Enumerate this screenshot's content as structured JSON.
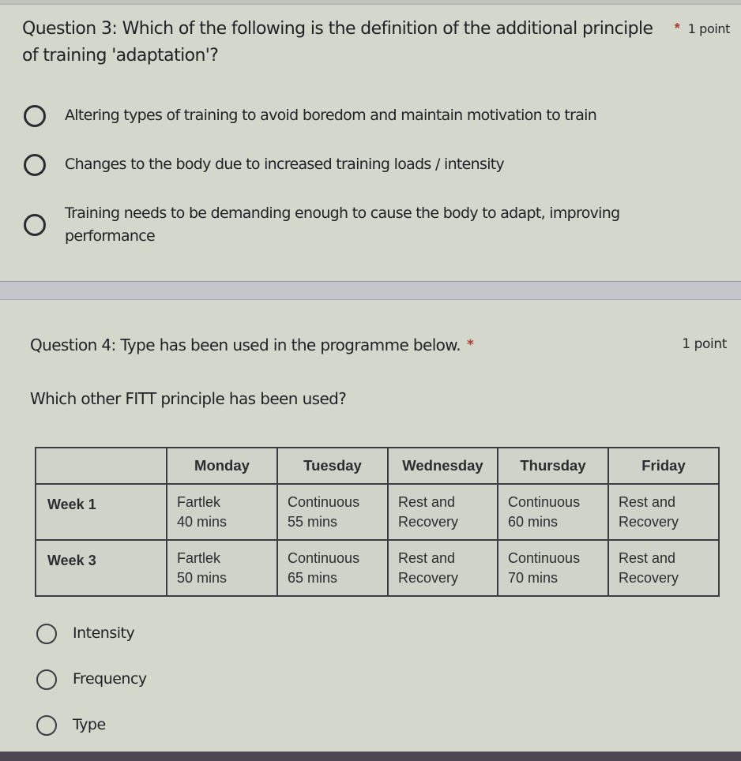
{
  "question3": {
    "title": "Question 3: Which of the following is the definition of the additional principle of training 'adaptation'?",
    "required_marker": "*",
    "points": "1 point",
    "options": [
      {
        "label": "Altering types of training to avoid boredom and maintain motivation to train",
        "selected": false
      },
      {
        "label": "Changes to the body due to increased training loads / intensity",
        "selected": false
      },
      {
        "label": "Training needs to be demanding enough to cause the body to adapt, improving performance",
        "selected": false
      }
    ]
  },
  "question4": {
    "title": "Question 4: Type has been used in the programme below.",
    "required_marker": "*",
    "points": "1 point",
    "subtitle": "Which other FITT principle has been used?",
    "table": {
      "headers": [
        "",
        "Monday",
        "Tuesday",
        "Wednesday",
        "Thursday",
        "Friday"
      ],
      "rows": [
        {
          "label": "Week 1",
          "cells": [
            {
              "line1": "Fartlek",
              "line2": "40 mins"
            },
            {
              "line1": "Continuous",
              "line2": "55 mins"
            },
            {
              "line1": "Rest and",
              "line2": "Recovery"
            },
            {
              "line1": "Continuous",
              "line2": "60 mins"
            },
            {
              "line1": "Rest and",
              "line2": "Recovery"
            }
          ]
        },
        {
          "label": "Week 3",
          "cells": [
            {
              "line1": "Fartlek",
              "line2": "50 mins"
            },
            {
              "line1": "Continuous",
              "line2": "65 mins"
            },
            {
              "line1": "Rest and",
              "line2": "Recovery"
            },
            {
              "line1": "Continuous",
              "line2": "70 mins"
            },
            {
              "line1": "Rest and",
              "line2": "Recovery"
            }
          ]
        }
      ]
    },
    "options": [
      {
        "label": "Intensity",
        "selected": false
      },
      {
        "label": "Frequency",
        "selected": false
      },
      {
        "label": "Type",
        "selected": false
      }
    ]
  },
  "colors": {
    "background": "#d3d7cc",
    "required_star": "#b23a32",
    "divider_band": "#c3c6cb",
    "text": "#1f2125"
  }
}
